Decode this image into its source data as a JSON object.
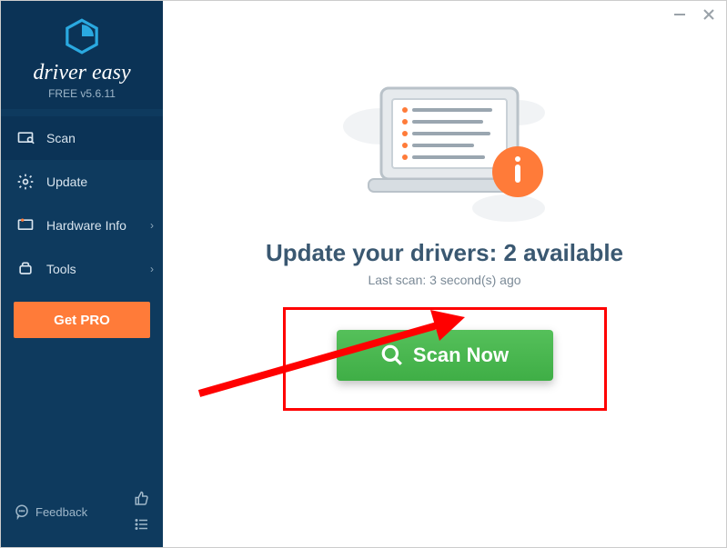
{
  "brand": {
    "name": "driver easy",
    "version": "FREE v5.6.11"
  },
  "nav": {
    "scan": "Scan",
    "update": "Update",
    "hardware": "Hardware Info",
    "tools": "Tools"
  },
  "get_pro": "Get PRO",
  "feedback": "Feedback",
  "main": {
    "headline": "Update your drivers: 2 available",
    "subline": "Last scan: 3 second(s) ago",
    "scan_button": "Scan Now"
  }
}
